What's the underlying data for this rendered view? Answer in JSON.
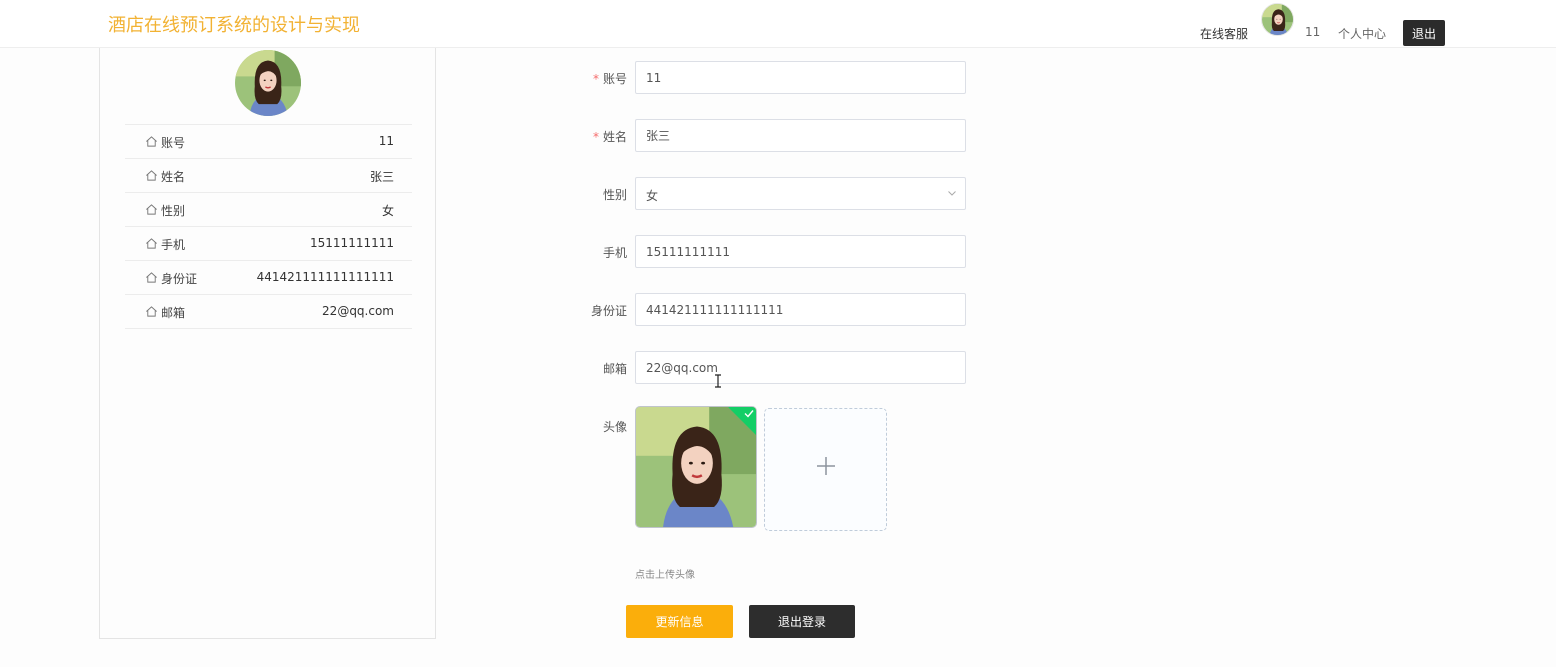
{
  "header": {
    "brand": "酒店在线预订系统的设计与实现",
    "service": "在线客服",
    "username": "11",
    "personal_center": "个人中心",
    "logout": "退出"
  },
  "profile": {
    "items": [
      {
        "label": "账号",
        "value": "11"
      },
      {
        "label": "姓名",
        "value": "张三"
      },
      {
        "label": "性别",
        "value": "女"
      },
      {
        "label": "手机",
        "value": "15111111111"
      },
      {
        "label": "身份证",
        "value": "441421111111111111"
      },
      {
        "label": "邮箱",
        "value": "22@qq.com"
      }
    ]
  },
  "form": {
    "account": {
      "label": "账号",
      "required_mark": "*",
      "value": "11"
    },
    "name": {
      "label": "姓名",
      "required_mark": "*",
      "value": "张三"
    },
    "gender": {
      "label": "性别",
      "value": "女"
    },
    "phone": {
      "label": "手机",
      "value": "15111111111"
    },
    "id_card": {
      "label": "身份证",
      "value": "441421111111111111"
    },
    "email": {
      "label": "邮箱",
      "value": "22@qq.com"
    },
    "avatar": {
      "label": "头像",
      "tip": "点击上传头像"
    },
    "update_button": "更新信息",
    "logout_button": "退出登录"
  },
  "colors": {
    "brand": "#f2b233",
    "primary_button": "#fbae0b",
    "dark_button": "#2d2d2d",
    "required": "#f56c6c",
    "upload_success": "#13ce66"
  }
}
